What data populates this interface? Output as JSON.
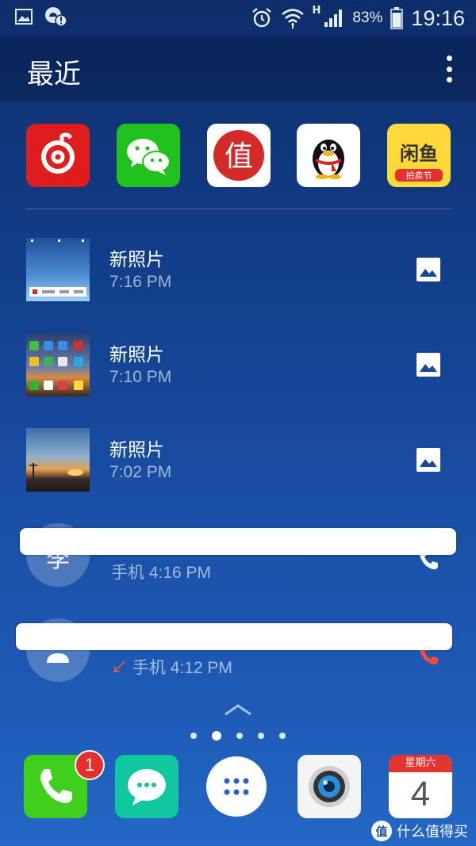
{
  "status_bar": {
    "time": "19:16",
    "battery_percent": "83%",
    "network_label": "H"
  },
  "header": {
    "title": "最近"
  },
  "recent_apps": [
    {
      "name": "netease-music",
      "icon": "netease-music-icon"
    },
    {
      "name": "wechat",
      "icon": "wechat-icon"
    },
    {
      "name": "smzdm",
      "icon": "smzdm-icon",
      "glyph": "值"
    },
    {
      "name": "qq",
      "icon": "qq-penguin-icon"
    },
    {
      "name": "xianyu",
      "icon": "xianyu-icon",
      "glyph": "闲鱼",
      "sub": "拍卖节"
    }
  ],
  "list": [
    {
      "title": "新照片",
      "time": "7:16 PM"
    },
    {
      "title": "新照片",
      "time": "7:10 PM"
    },
    {
      "title": "新照片",
      "time": "7:02 PM"
    },
    {
      "avatar": "李",
      "label": "手机",
      "time": "4:16 PM"
    },
    {
      "label": "手机",
      "time": "4:12 PM",
      "missed_glyph": "↙"
    }
  ],
  "pagination": {
    "count": 5,
    "active_index": 1
  },
  "dock": {
    "phone_badge": "1",
    "calendar_weekday": "星期六",
    "calendar_day": "4"
  },
  "watermark": {
    "logo": "值",
    "text": "什么值得买"
  },
  "colors": {
    "missed_call": "#ff5a3c",
    "badge": "#e42f2f"
  }
}
